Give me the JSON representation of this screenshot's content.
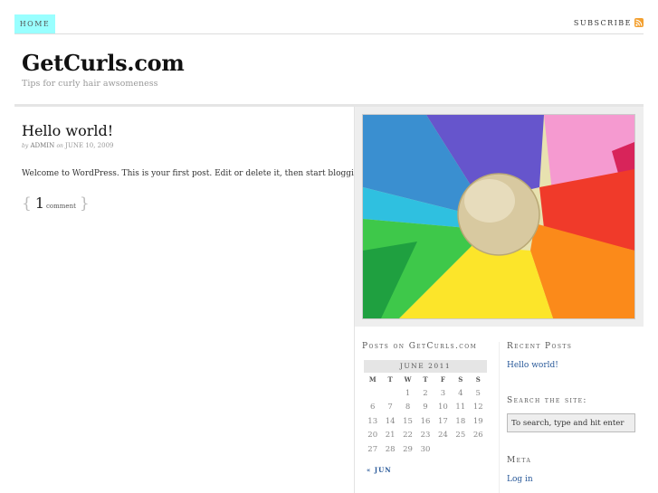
{
  "nav": {
    "home_label": "HOME",
    "subscribe_label": "SUBSCRIBE",
    "rss_icon": "rss-icon",
    "home_color": "#99ffff"
  },
  "header": {
    "title": "GetCurls.com",
    "description": "Tips for curly hair awsomeness"
  },
  "post": {
    "title": "Hello world!",
    "by": "by",
    "author": "ADMIN",
    "on": "on",
    "date": "JUNE 10, 2009",
    "body": "Welcome to WordPress. This is your first post. Edit or delete it, then start blogging!",
    "open_brace": "{",
    "comment_count": "1",
    "comment_word": "comment",
    "close_brace": "}"
  },
  "sidebar": {
    "calendar_title": "Posts on GetCurls.com",
    "calendar": {
      "caption": "JUNE 2011",
      "days": [
        "M",
        "T",
        "W",
        "T",
        "F",
        "S",
        "S"
      ],
      "weeks": [
        [
          "",
          "",
          "1",
          "2",
          "3",
          "4",
          "5"
        ],
        [
          "6",
          "7",
          "8",
          "9",
          "10",
          "11",
          "12"
        ],
        [
          "13",
          "14",
          "15",
          "16",
          "17",
          "18",
          "19"
        ],
        [
          "20",
          "21",
          "22",
          "23",
          "24",
          "25",
          "26"
        ],
        [
          "27",
          "28",
          "29",
          "30",
          "",
          "",
          ""
        ]
      ],
      "prev": "« JUN"
    },
    "recent_title": "Recent Posts",
    "recent_link": "Hello world!",
    "search_title": "Search the site:",
    "search_placeholder": "To search, type and hit enter",
    "meta_title": "Meta",
    "login_link": "Log in"
  },
  "colors": {
    "link": "#2a5a9a",
    "rss": "#f3a030"
  }
}
